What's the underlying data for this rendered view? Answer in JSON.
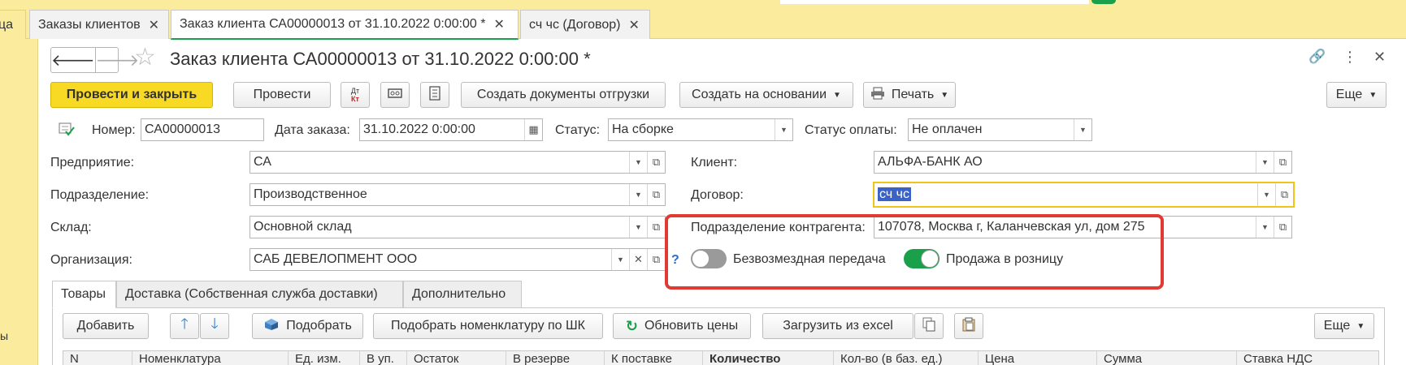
{
  "window_tabs": [
    {
      "label": "ца"
    },
    {
      "label": "Заказы клиентов",
      "close": "✕"
    },
    {
      "label": "Заказ клиента СА00000013 от 31.10.2022 0:00:00 *",
      "close": "✕"
    },
    {
      "label": "сч чс (Договор)",
      "close": "✕"
    }
  ],
  "sidebar": {
    "fragment": "ы"
  },
  "header": {
    "title": "Заказ клиента СА00000013 от 31.10.2022 0:00:00 *",
    "back": "🡐",
    "forward": "🡒",
    "star": "☆",
    "link_icon": "🔗",
    "more_icon": "⋮",
    "close_icon": "✕"
  },
  "toolbar": {
    "post_close": "Провести и закрыть",
    "post": "Провести",
    "dtkt": {
      "dt": "Дт",
      "kt": "Кт"
    },
    "create_shipping": "Создать документы отгрузки",
    "create_based": "Создать на основании",
    "print": "Печать",
    "more": "Еще"
  },
  "fields": {
    "number_label": "Номер:",
    "number": "СА00000013",
    "date_label": "Дата заказа:",
    "date": "31.10.2022  0:00:00",
    "status_label": "Статус:",
    "status": "На сборке",
    "pay_status_label": "Статус оплаты:",
    "pay_status": "Не оплачен",
    "enterprise_label": "Предприятие:",
    "enterprise": "СА",
    "division_label": "Подразделение:",
    "division": "Производственное",
    "warehouse_label": "Склад:",
    "warehouse": "Основной склад",
    "organization_label": "Организация:",
    "organization": "САБ ДЕВЕЛОПМЕНТ ООО",
    "client_label": "Клиент:",
    "client": "АЛЬФА-БАНК АО",
    "contract_label": "Договор:",
    "contract": "сч чс",
    "counterparty_division_label": "Подразделение контрагента:",
    "counterparty_division": "107078, Москва г, Каланчевская ул, дом 275",
    "help": "?",
    "free_transfer_label": "Безвозмездная передача",
    "free_transfer_on": false,
    "retail_label": "Продажа в розницу",
    "retail_on": true
  },
  "form_tabs": [
    "Товары",
    "Доставка (Собственная служба доставки)",
    "Дополнительно"
  ],
  "goods_toolbar": {
    "add": "Добавить",
    "pick": "Подобрать",
    "pick_barcode": "Подобрать номенклатуру по ШК",
    "refresh_prices": "Обновить цены",
    "load_excel": "Загрузить из excel",
    "more": "Еще"
  },
  "table_headers": [
    "N",
    "Номенклатура",
    "Ед. изм.",
    "В уп.",
    "Остаток",
    "В резерве",
    "К поставке",
    "Количество",
    "Кол-во (в баз. ед.)",
    "Цена",
    "Сумма",
    "Ставка НДС"
  ],
  "colors": {
    "accent": "#f8d923",
    "toggle_on": "#1aa04a",
    "highlight": "#e03a33"
  }
}
